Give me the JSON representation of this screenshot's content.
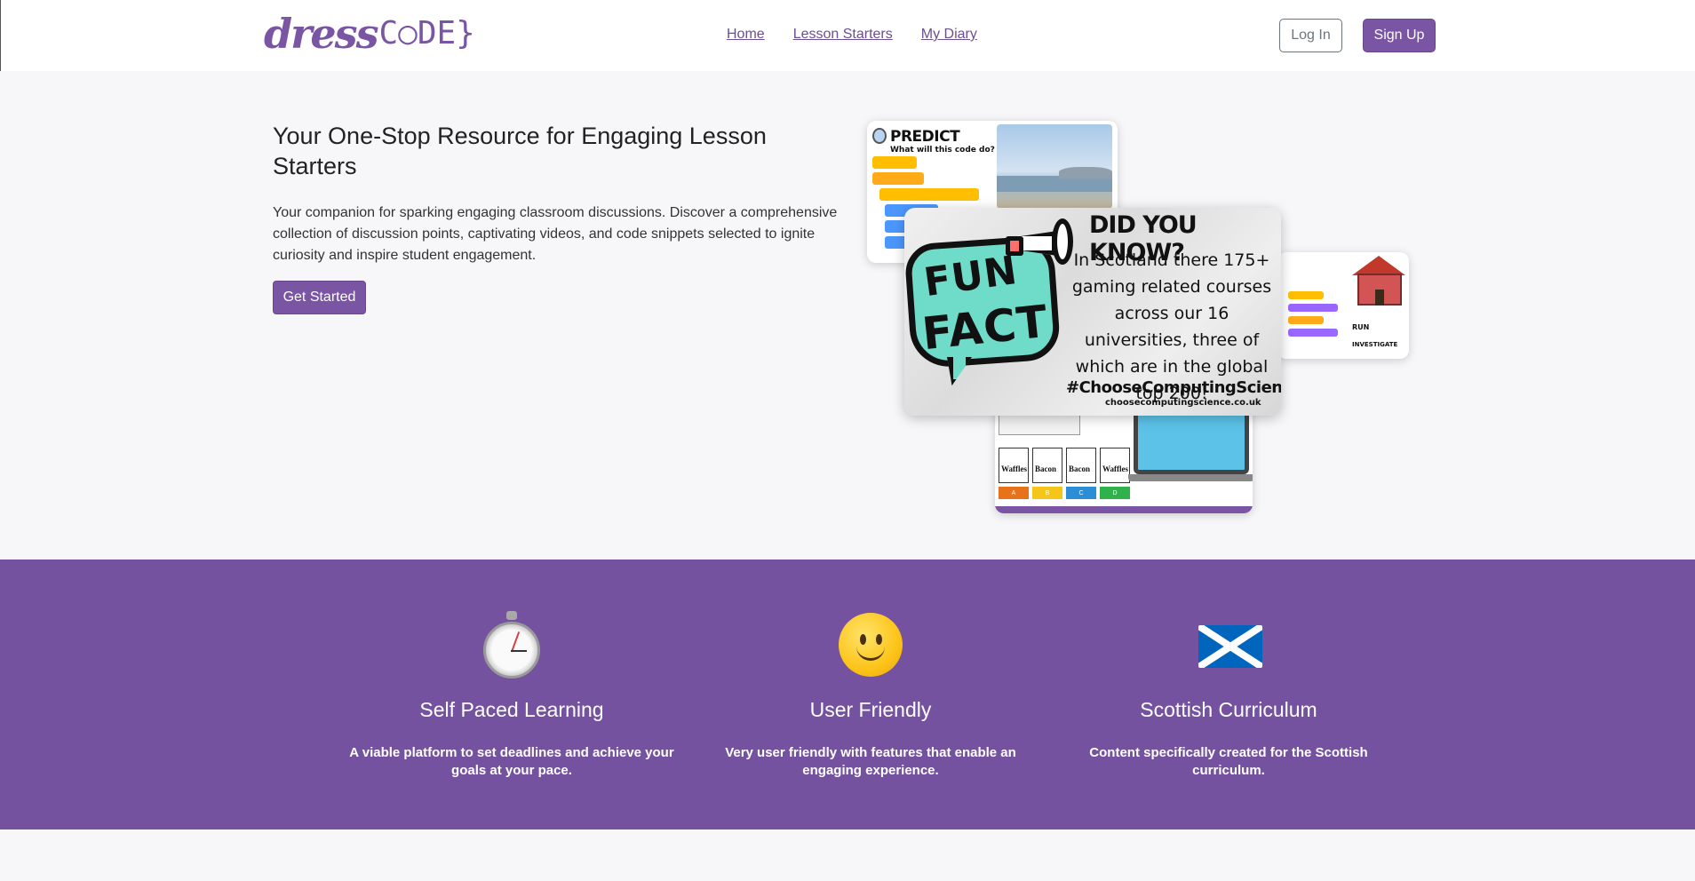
{
  "nav": {
    "logo_dress": "dress",
    "logo_code": "C○DE}",
    "links": [
      "Home",
      "Lesson Starters",
      "My Diary"
    ],
    "login_label": "Log In",
    "signup_label": "Sign Up"
  },
  "hero": {
    "title": "Your One-Stop Resource for Engaging Lesson Starters",
    "description": "Your companion for sparking engaging classroom discussions. Discover a comprehensive collection of discussion points, captivating videos, and code snippets selected to ignite curiosity and inspire student engagement.",
    "cta_label": "Get Started"
  },
  "collage": {
    "predict_title": "PREDICT",
    "predict_subtitle": "What will this code do?",
    "fun_word": "FUN",
    "fact_word": "FACT",
    "did_you_know": "DID YOU KNOW?",
    "fun_body": "In Scotland there 175+ gaming related courses across our 16 universities, three of which are in the global top 200!",
    "hashtag": "#ChooseComputingScience",
    "url": "choosecomputingscience.co.uk",
    "run_label": "RUN",
    "investigate_label": "INVESTIGATE",
    "quiz_options": [
      "Waffles",
      "Bacon",
      "Bacon",
      "Waffles"
    ],
    "quiz_letters": [
      "A",
      "B",
      "C",
      "D"
    ],
    "quiz_colors": [
      "#e8711a",
      "#f5c518",
      "#2a8fd6",
      "#2fb24c"
    ]
  },
  "features": [
    {
      "icon": "stopwatch-icon",
      "title": "Self Paced Learning",
      "description": "A viable platform to set deadlines and achieve your goals at your pace."
    },
    {
      "icon": "smiley-icon",
      "title": "User Friendly",
      "description": "Very user friendly with features that enable an engaging experience."
    },
    {
      "icon": "scotland-flag-icon",
      "title": "Scottish Curriculum",
      "description": "Content specifically created for the Scottish curriculum."
    }
  ],
  "colors": {
    "brand_purple": "#7a55a3",
    "features_bg": "#7552a0"
  }
}
